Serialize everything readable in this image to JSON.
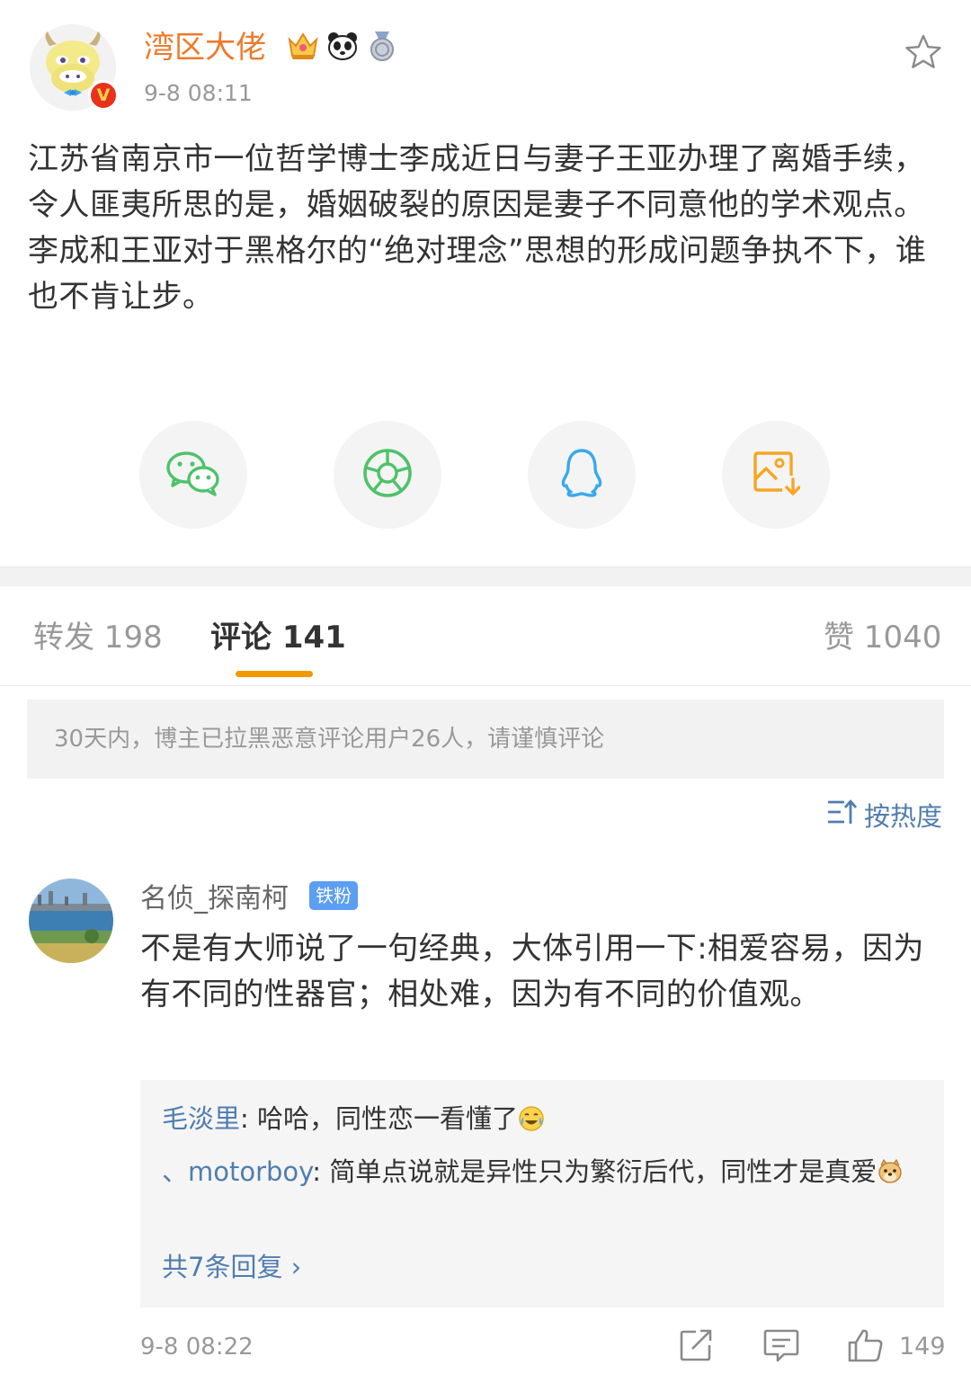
{
  "post": {
    "username": "湾区大佬",
    "time": "9-8 08:11",
    "verified_mark": "V",
    "badges": [
      "crown-badge-icon",
      "panda-badge-icon",
      "medal-badge-icon"
    ],
    "paragraph1": "江苏省南京市一位哲学博士李成近日与妻子王亚办理了离婚手续，令人匪夷所思的是，婚姻破裂的原因是妻子不同意他的学术观点。",
    "paragraph2": "李成和王亚对于黑格尔的“绝对理念”思想的形成问题争执不下，谁也不肯让步。"
  },
  "share": [
    "wechat-icon",
    "moments-icon",
    "qq-icon",
    "save-image-icon"
  ],
  "tabs": {
    "repost": "转发 198",
    "comment": "评论 141",
    "like": "赞 1040"
  },
  "notice": "30天内，博主已拉黑恶意评论用户26人，请谨慎评论",
  "sort_label": "按热度",
  "comment": {
    "name": "名侦_探南柯",
    "badge": "铁粉",
    "text": "不是有大师说了一句经典，大体引用一下:相爱容易，因为有不同的性器官；相处难，因为有不同的价值观。",
    "replies": [
      {
        "name": "毛淡里",
        "text": ": 哈哈，同性恋一看懂了"
      },
      {
        "name": "、motorboy",
        "text": ": 简单点说就是异性只为繁衍后代，同性才是真爱"
      }
    ],
    "more_replies": "共7条回复 ›",
    "time": "9-8 08:22",
    "likes": "149"
  },
  "colors": {
    "accent_orange": "#f39800",
    "username_orange": "#ee7a2a",
    "link_blue": "#507daf",
    "wechat_green": "#4ec26b",
    "qq_blue": "#3aa9ea",
    "save_orange": "#f6a623"
  }
}
